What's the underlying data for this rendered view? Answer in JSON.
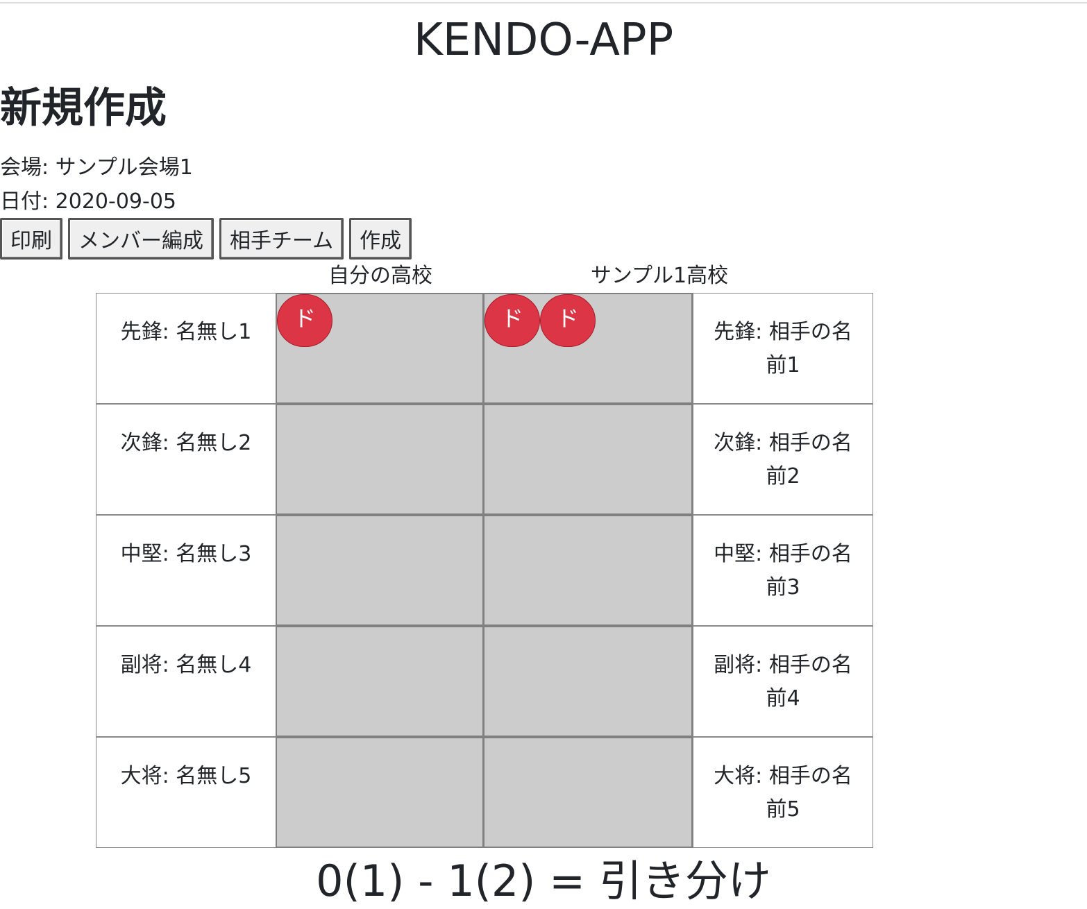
{
  "header": {
    "app_title": "KENDO-APP",
    "page_title": "新規作成"
  },
  "meta": {
    "venue": "会場: サンプル会場1",
    "date": "日付: 2020-09-05"
  },
  "toolbar": {
    "print_label": "印刷",
    "members_label": "メンバー編成",
    "opponent_label": "相手チーム",
    "create_label": "作成"
  },
  "teams": {
    "self": "自分の高校",
    "opponent": "サンプル1高校"
  },
  "matches": [
    {
      "self_player": "先鋒: 名無し1",
      "opp_player": "先鋒: 相手の名前1",
      "self_points": [
        "ド"
      ],
      "opp_points": [
        "ド",
        "ド"
      ]
    },
    {
      "self_player": "次鋒: 名無し2",
      "opp_player": "次鋒: 相手の名前2",
      "self_points": [],
      "opp_points": []
    },
    {
      "self_player": "中堅: 名無し3",
      "opp_player": "中堅: 相手の名前3",
      "self_points": [],
      "opp_points": []
    },
    {
      "self_player": "副将: 名無し4",
      "opp_player": "副将: 相手の名前4",
      "self_points": [],
      "opp_points": []
    },
    {
      "self_player": "大将: 名無し5",
      "opp_player": "大将: 相手の名前5",
      "self_points": [],
      "opp_points": []
    }
  ],
  "result": "0(1) - 1(2) = 引き分け",
  "colors": {
    "point_chip": "#dc3545",
    "score_cell": "#cccccc"
  }
}
